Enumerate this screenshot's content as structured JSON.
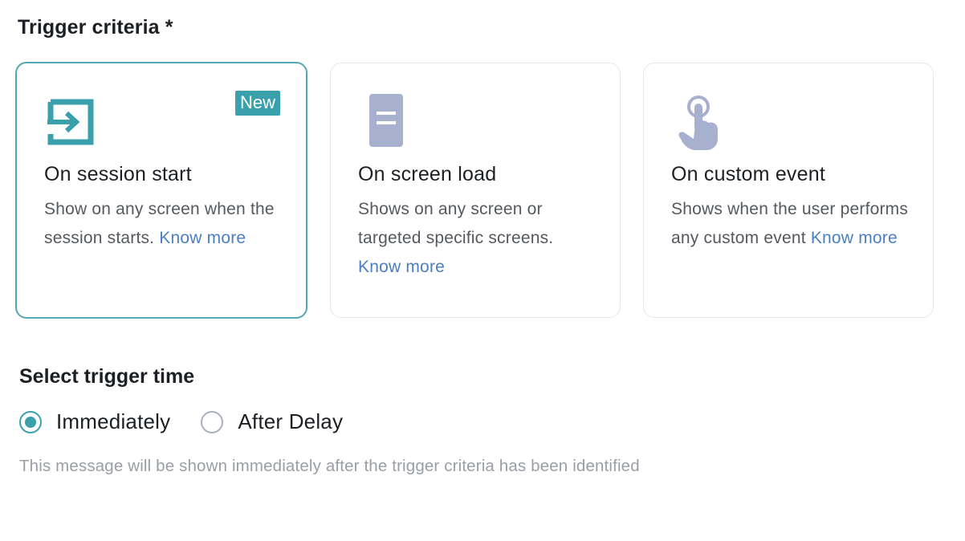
{
  "trigger_criteria": {
    "title": "Trigger criteria *",
    "cards": [
      {
        "icon": "login-arrow-icon",
        "title": "On session start",
        "badge": "New",
        "desc": "Show on any screen when the session starts.",
        "link": "Know more",
        "selected": true
      },
      {
        "icon": "document-icon",
        "title": "On screen load",
        "desc": "Shows on any screen or targeted specific screens.",
        "link": "Know more",
        "selected": false
      },
      {
        "icon": "tap-hand-icon",
        "title": "On custom event",
        "desc": "Shows when the user performs any custom event",
        "link": "Know more",
        "selected": false
      }
    ]
  },
  "trigger_time": {
    "title": "Select trigger time",
    "options": [
      {
        "label": "Immediately",
        "checked": true
      },
      {
        "label": "After Delay",
        "checked": false
      }
    ],
    "helper": "This message will be shown immediately after the trigger criteria has been identified"
  },
  "colors": {
    "accent": "#3aa0ac",
    "selected_border": "#56a7b3",
    "icon_muted": "#a7b0cf",
    "link": "#4a7fc1"
  }
}
